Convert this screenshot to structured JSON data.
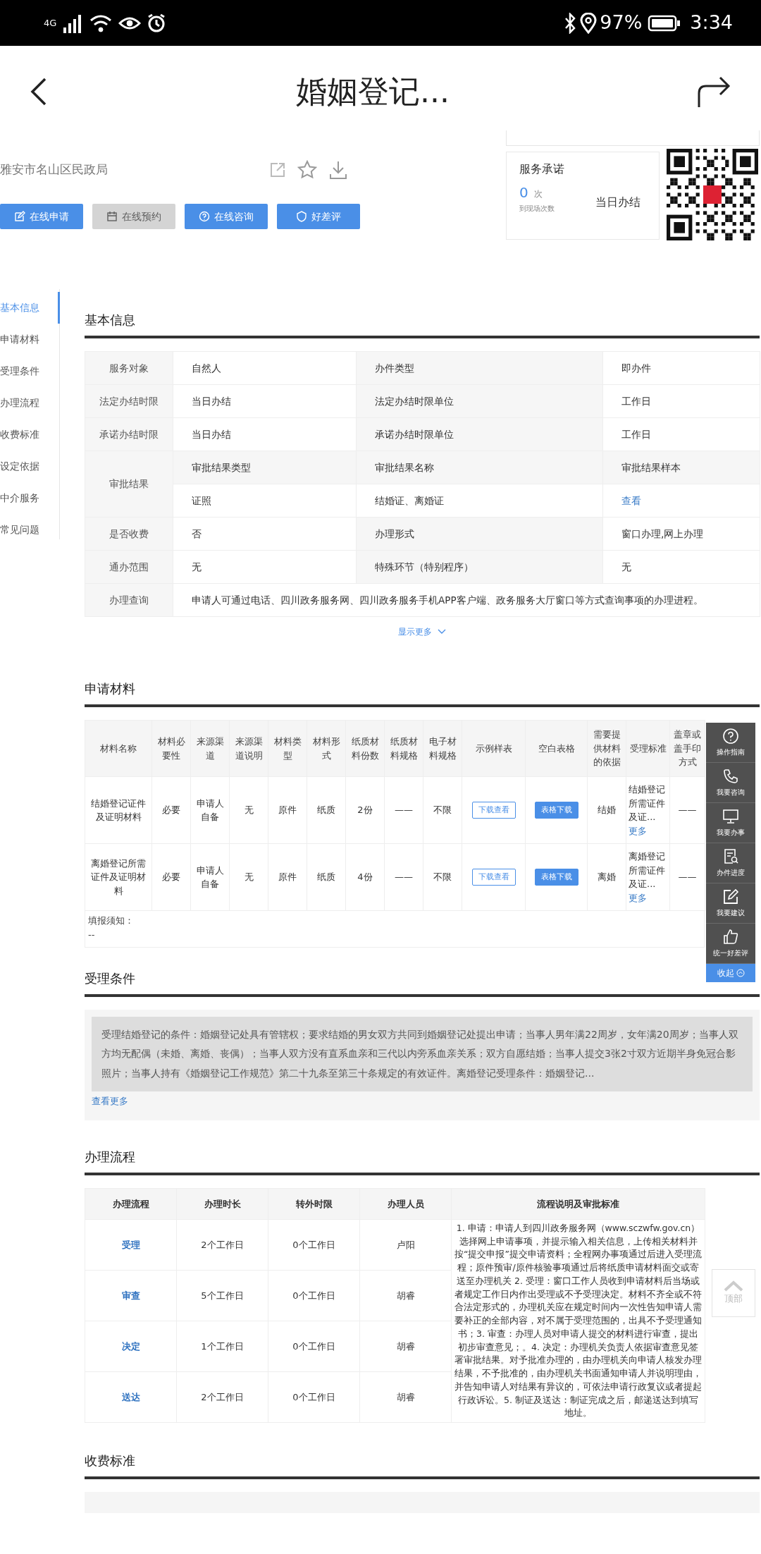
{
  "status_bar": {
    "network": "4G",
    "battery": "97%",
    "time": "3:34"
  },
  "header": {
    "title": "婚姻登记..."
  },
  "department": "雅安市名山区民政局",
  "actions": [
    {
      "kind": "edit",
      "label": "在线申请",
      "disabled": false
    },
    {
      "kind": "calendar",
      "label": "在线预约",
      "disabled": true
    },
    {
      "kind": "question",
      "label": "在线咨询",
      "disabled": false
    },
    {
      "kind": "shield",
      "label": "好差评",
      "disabled": false
    }
  ],
  "service_promise": {
    "title": "服务承诺",
    "count": "0",
    "count_unit": "次",
    "count_label": "到现场次数",
    "result": "当日办结"
  },
  "side_nav": [
    {
      "label": "基本信息",
      "selected": true
    },
    {
      "label": "申请材料",
      "selected": false
    },
    {
      "label": "受理条件",
      "selected": false
    },
    {
      "label": "办理流程",
      "selected": false
    },
    {
      "label": "收费标准",
      "selected": false
    },
    {
      "label": "设定依据",
      "selected": false
    },
    {
      "label": "中介服务",
      "selected": false
    },
    {
      "label": "常见问题",
      "selected": false
    }
  ],
  "basic_info": {
    "title": "基本信息",
    "rows": [
      {
        "kind": "pair",
        "cells": [
          "服务对象",
          "自然人",
          "办件类型",
          "即办件"
        ]
      },
      {
        "kind": "pair",
        "cells": [
          "法定办结时限",
          "当日办结",
          "法定办结时限单位",
          "工作日"
        ]
      },
      {
        "kind": "pair",
        "cells": [
          "承诺办结时限",
          "当日办结",
          "承诺办结时限单位",
          "工作日"
        ]
      },
      {
        "kind": "group",
        "label": "审批结果",
        "subrows": [
          [
            {
              "kind": "text",
              "text": "审批结果类型"
            },
            {
              "kind": "text",
              "text": "审批结果名称"
            },
            {
              "kind": "text",
              "text": "审批结果样本"
            }
          ],
          [
            {
              "kind": "text",
              "text": "证照"
            },
            {
              "kind": "text",
              "text": "结婚证、离婚证"
            },
            {
              "kind": "link",
              "text": "查看"
            }
          ]
        ]
      },
      {
        "kind": "pair",
        "cells": [
          "是否收费",
          "否",
          "办理形式",
          "窗口办理,网上办理"
        ]
      },
      {
        "kind": "pair",
        "cells": [
          "通办范围",
          "无",
          "特殊环节（特别程序）",
          "无"
        ]
      },
      {
        "kind": "wide",
        "label": "办理查询",
        "value": "申请人可通过电话、四川政务服务网、四川政务服务手机APP客户端、政务服务大厅窗口等方式查询事项的办理进程。"
      }
    ],
    "show_more": "显示更多"
  },
  "materials": {
    "title": "申请材料",
    "columns": [
      "材料名称",
      "材料必要性",
      "来源渠道",
      "来源渠道说明",
      "材料类型",
      "材料形式",
      "纸质材料份数",
      "纸质材料规格",
      "电子材料规格",
      "示例样表",
      "空白表格",
      "需要提供材料的依据",
      "受理标准",
      "盖章或盖手印方式"
    ],
    "rows": [
      {
        "cells": [
          "结婚登记证件及证明材料",
          "必要",
          "申请人自备",
          "无",
          "原件",
          "纸质",
          "2份",
          "——",
          "不限"
        ],
        "sample_button": "下载查看",
        "blank_button": "表格下载",
        "basis": "结婚",
        "standard": "结婚登记所需证件及证...",
        "standard_more": "更多",
        "seal": "——"
      },
      {
        "cells": [
          "离婚登记所需证件及证明材料",
          "必要",
          "申请人自备",
          "无",
          "原件",
          "纸质",
          "4份",
          "——",
          "不限"
        ],
        "sample_button": "下载查看",
        "blank_button": "表格下载",
        "basis": "离婚",
        "standard": "离婚登记所需证件及证...",
        "standard_more": "更多",
        "seal": "——"
      }
    ],
    "notes_label": "填报须知：",
    "notes_value": "--"
  },
  "conditions": {
    "title": "受理条件",
    "text": "受理结婚登记的条件：婚姻登记处具有管辖权；要求结婚的男女双方共同到婚姻登记处提出申请；当事人男年满22周岁，女年满20周岁；当事人双方均无配偶（未婚、离婚、丧偶）；当事人双方没有直系血亲和三代以内旁系血亲关系；双方自愿结婚；当事人提交3张2寸双方近期半身免冠合影照片；当事人持有《婚姻登记工作规范》第二十九条至第三十条规定的有效证件。离婚登记受理条件：婚姻登记...",
    "more": "查看更多"
  },
  "process": {
    "title": "办理流程",
    "columns": [
      "办理流程",
      "办理时长",
      "转外时限",
      "办理人员",
      "流程说明及审批标准"
    ],
    "rows": [
      {
        "step": "受理",
        "duration": "2个工作日",
        "transfer": "0个工作日",
        "handler": "卢阳"
      },
      {
        "step": "审查",
        "duration": "5个工作日",
        "transfer": "0个工作日",
        "handler": "胡睿"
      },
      {
        "step": "决定",
        "duration": "1个工作日",
        "transfer": "0个工作日",
        "handler": "胡睿"
      },
      {
        "step": "送达",
        "duration": "2个工作日",
        "transfer": "0个工作日",
        "handler": "胡睿"
      }
    ],
    "description": "1. 申请：申请人到四川政务服务网（www.sczwfw.gov.cn）选择网上申请事项，并提示输入相关信息，上传相关材料并按“提交申报”提交申请资料；全程网办事项通过后进入受理流程；原件预审/原件核验事项通过后将纸质申请材料面交或寄送至办理机关 2. 受理：窗口工作人员收到申请材料后当场或者规定工作日内作出受理或不予受理决定。材料不齐全或不符合法定形式的，办理机关应在规定时间内一次性告知申请人需要补正的全部内容，对不属于受理范围的，出具不予受理通知书；3. 审查：办理人员对申请人提交的材料进行审查，提出初步审查意见；。4. 决定：办理机关负责人依据审查意见签署审批结果。对予批准办理的，由办理机关向申请人核发办理结果，不予批准的，由办理机关书面通知申请人并说明理由，并告知申请人对结果有异议的，可依法申请行政复议或者提起行政诉讼。5. 制证及送达：制证完成之后，邮递送达到填写地址。"
  },
  "fees": {
    "title": "收费标准"
  },
  "float_panel": {
    "items": [
      {
        "kind": "question",
        "label": "操作指南"
      },
      {
        "kind": "phone",
        "label": "我要咨询"
      },
      {
        "kind": "monitor",
        "label": "我要办事"
      },
      {
        "kind": "progress",
        "label": "办件进度"
      },
      {
        "kind": "edit",
        "label": "我要建议"
      },
      {
        "kind": "thumb",
        "label": "统一好差评"
      }
    ],
    "collapse": "收起"
  },
  "back_to_top": "顶部"
}
